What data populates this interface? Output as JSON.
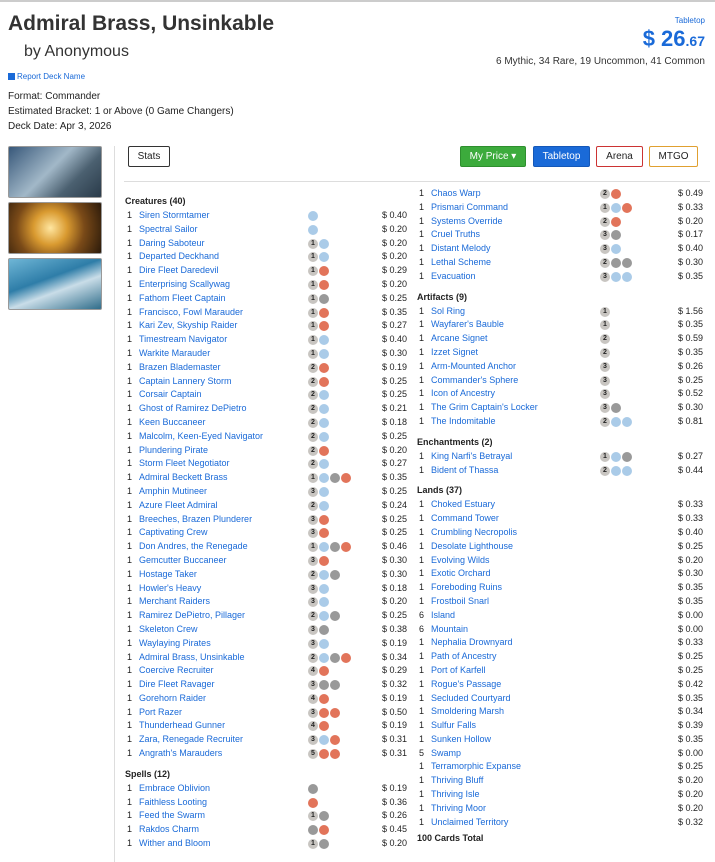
{
  "deck": {
    "title": "Admiral Brass, Unsinkable",
    "author": "by Anonymous",
    "report": "Report Deck Name",
    "format": "Format: Commander",
    "bracket": "Estimated Bracket: 1 or Above (0 Game Changers)",
    "date": "Deck Date: Apr 3, 2026"
  },
  "price": {
    "label": "Tabletop",
    "dollars": "$ 26",
    "cents": ".67"
  },
  "rarity": "6 Mythic, 34 Rare, 19 Uncommon, 41 Common",
  "buttons": {
    "stats": "Stats",
    "my_price": "My Price ▾",
    "tabletop": "Tabletop",
    "arena": "Arena",
    "mtgo": "MTGO"
  },
  "colors": {
    "link": "#1a6ad8",
    "green": "#3cab3c",
    "red": "#cc3333",
    "orange": "#e0a030",
    "blue_mana": "#aacbe8",
    "red_mana": "#e2745a",
    "black_mana": "#999999",
    "generic_mana": "#c8c5c1"
  },
  "creatures_header": "Creatures (40)",
  "creatures": [
    {
      "q": "1",
      "n": "Siren Stormtamer",
      "m": [
        "U"
      ],
      "p": "$ 0.40"
    },
    {
      "q": "1",
      "n": "Spectral Sailor",
      "m": [
        "U"
      ],
      "p": "$ 0.20"
    },
    {
      "q": "1",
      "n": "Daring Saboteur",
      "m": [
        "1",
        "U"
      ],
      "p": "$ 0.20"
    },
    {
      "q": "1",
      "n": "Departed Deckhand",
      "m": [
        "1",
        "U"
      ],
      "p": "$ 0.20"
    },
    {
      "q": "1",
      "n": "Dire Fleet Daredevil",
      "m": [
        "1",
        "R"
      ],
      "p": "$ 0.29"
    },
    {
      "q": "1",
      "n": "Enterprising Scallywag",
      "m": [
        "1",
        "R"
      ],
      "p": "$ 0.20"
    },
    {
      "q": "1",
      "n": "Fathom Fleet Captain",
      "m": [
        "1",
        "B"
      ],
      "p": "$ 0.25"
    },
    {
      "q": "1",
      "n": "Francisco, Fowl Marauder",
      "m": [
        "1",
        "R"
      ],
      "p": "$ 0.35"
    },
    {
      "q": "1",
      "n": "Kari Zev, Skyship Raider",
      "m": [
        "1",
        "R"
      ],
      "p": "$ 0.27"
    },
    {
      "q": "1",
      "n": "Timestream Navigator",
      "m": [
        "1",
        "U"
      ],
      "p": "$ 0.40"
    },
    {
      "q": "1",
      "n": "Warkite Marauder",
      "m": [
        "1",
        "U"
      ],
      "p": "$ 0.30"
    },
    {
      "q": "1",
      "n": "Brazen Blademaster",
      "m": [
        "2",
        "R"
      ],
      "p": "$ 0.19"
    },
    {
      "q": "1",
      "n": "Captain Lannery Storm",
      "m": [
        "2",
        "R"
      ],
      "p": "$ 0.25"
    },
    {
      "q": "1",
      "n": "Corsair Captain",
      "m": [
        "2",
        "U"
      ],
      "p": "$ 0.25"
    },
    {
      "q": "1",
      "n": "Ghost of Ramirez DePietro",
      "m": [
        "2",
        "U"
      ],
      "p": "$ 0.21"
    },
    {
      "q": "1",
      "n": "Keen Buccaneer",
      "m": [
        "2",
        "U"
      ],
      "p": "$ 0.18"
    },
    {
      "q": "1",
      "n": "Malcolm, Keen-Eyed Navigator",
      "m": [
        "2",
        "U"
      ],
      "p": "$ 0.25"
    },
    {
      "q": "1",
      "n": "Plundering Pirate",
      "m": [
        "2",
        "R"
      ],
      "p": "$ 0.20"
    },
    {
      "q": "1",
      "n": "Storm Fleet Negotiator",
      "m": [
        "2",
        "U"
      ],
      "p": "$ 0.27"
    },
    {
      "q": "1",
      "n": "Admiral Beckett Brass",
      "m": [
        "1",
        "U",
        "B",
        "R"
      ],
      "p": "$ 0.35"
    },
    {
      "q": "1",
      "n": "Amphin Mutineer",
      "m": [
        "3",
        "U"
      ],
      "p": "$ 0.25"
    },
    {
      "q": "1",
      "n": "Azure Fleet Admiral",
      "m": [
        "2",
        "U"
      ],
      "p": "$ 0.24"
    },
    {
      "q": "1",
      "n": "Breeches, Brazen Plunderer",
      "m": [
        "3",
        "R"
      ],
      "p": "$ 0.25"
    },
    {
      "q": "1",
      "n": "Captivating Crew",
      "m": [
        "3",
        "R"
      ],
      "p": "$ 0.25"
    },
    {
      "q": "1",
      "n": "Don Andres, the Renegade",
      "m": [
        "1",
        "U",
        "B",
        "R"
      ],
      "p": "$ 0.46"
    },
    {
      "q": "1",
      "n": "Gemcutter Buccaneer",
      "m": [
        "3",
        "R"
      ],
      "p": "$ 0.30"
    },
    {
      "q": "1",
      "n": "Hostage Taker",
      "m": [
        "2",
        "U",
        "B"
      ],
      "p": "$ 0.30"
    },
    {
      "q": "1",
      "n": "Howler's Heavy",
      "m": [
        "3",
        "U"
      ],
      "p": "$ 0.18"
    },
    {
      "q": "1",
      "n": "Merchant Raiders",
      "m": [
        "3",
        "U"
      ],
      "p": "$ 0.20"
    },
    {
      "q": "1",
      "n": "Ramirez DePietro, Pillager",
      "m": [
        "2",
        "U",
        "B"
      ],
      "p": "$ 0.25"
    },
    {
      "q": "1",
      "n": "Skeleton Crew",
      "m": [
        "3",
        "B"
      ],
      "p": "$ 0.38"
    },
    {
      "q": "1",
      "n": "Waylaying Pirates",
      "m": [
        "3",
        "U"
      ],
      "p": "$ 0.19"
    },
    {
      "q": "1",
      "n": "Admiral Brass, Unsinkable",
      "m": [
        "2",
        "U",
        "B",
        "R"
      ],
      "p": "$ 0.34"
    },
    {
      "q": "1",
      "n": "Coercive Recruiter",
      "m": [
        "4",
        "R"
      ],
      "p": "$ 0.29"
    },
    {
      "q": "1",
      "n": "Dire Fleet Ravager",
      "m": [
        "3",
        "B",
        "B"
      ],
      "p": "$ 0.32"
    },
    {
      "q": "1",
      "n": "Gorehorn Raider",
      "m": [
        "4",
        "R"
      ],
      "p": "$ 0.19"
    },
    {
      "q": "1",
      "n": "Port Razer",
      "m": [
        "3",
        "R",
        "R"
      ],
      "p": "$ 0.50"
    },
    {
      "q": "1",
      "n": "Thunderhead Gunner",
      "m": [
        "4",
        "R"
      ],
      "p": "$ 0.19"
    },
    {
      "q": "1",
      "n": "Zara, Renegade Recruiter",
      "m": [
        "3",
        "U",
        "R"
      ],
      "p": "$ 0.31"
    },
    {
      "q": "1",
      "n": "Angrath's Marauders",
      "m": [
        "5",
        "R",
        "R"
      ],
      "p": "$ 0.31"
    }
  ],
  "spells_header": "Spells (12)",
  "spells_left": [
    {
      "q": "1",
      "n": "Embrace Oblivion",
      "m": [
        "B"
      ],
      "p": "$ 0.19"
    },
    {
      "q": "1",
      "n": "Faithless Looting",
      "m": [
        "R"
      ],
      "p": "$ 0.36"
    },
    {
      "q": "1",
      "n": "Feed the Swarm",
      "m": [
        "1",
        "B"
      ],
      "p": "$ 0.26"
    },
    {
      "q": "1",
      "n": "Rakdos Charm",
      "m": [
        "B",
        "R"
      ],
      "p": "$ 0.45"
    },
    {
      "q": "1",
      "n": "Wither and Bloom",
      "m": [
        "1",
        "B"
      ],
      "p": "$ 0.20"
    }
  ],
  "spells_right": [
    {
      "q": "1",
      "n": "Chaos Warp",
      "m": [
        "2",
        "R"
      ],
      "p": "$ 0.49"
    },
    {
      "q": "1",
      "n": "Prismari Command",
      "m": [
        "1",
        "U",
        "R"
      ],
      "p": "$ 0.33"
    },
    {
      "q": "1",
      "n": "Systems Override",
      "m": [
        "2",
        "R"
      ],
      "p": "$ 0.20"
    },
    {
      "q": "1",
      "n": "Cruel Truths",
      "m": [
        "3",
        "B"
      ],
      "p": "$ 0.17"
    },
    {
      "q": "1",
      "n": "Distant Melody",
      "m": [
        "3",
        "U"
      ],
      "p": "$ 0.40"
    },
    {
      "q": "1",
      "n": "Lethal Scheme",
      "m": [
        "2",
        "B",
        "B"
      ],
      "p": "$ 0.30"
    },
    {
      "q": "1",
      "n": "Evacuation",
      "m": [
        "3",
        "U",
        "U"
      ],
      "p": "$ 0.35"
    }
  ],
  "artifacts_header": "Artifacts (9)",
  "artifacts": [
    {
      "q": "1",
      "n": "Sol Ring",
      "m": [
        "1"
      ],
      "p": "$ 1.56"
    },
    {
      "q": "1",
      "n": "Wayfarer's Bauble",
      "m": [
        "1"
      ],
      "p": "$ 0.35"
    },
    {
      "q": "1",
      "n": "Arcane Signet",
      "m": [
        "2"
      ],
      "p": "$ 0.59"
    },
    {
      "q": "1",
      "n": "Izzet Signet",
      "m": [
        "2"
      ],
      "p": "$ 0.35"
    },
    {
      "q": "1",
      "n": "Arm-Mounted Anchor",
      "m": [
        "3"
      ],
      "p": "$ 0.26"
    },
    {
      "q": "1",
      "n": "Commander's Sphere",
      "m": [
        "3"
      ],
      "p": "$ 0.25"
    },
    {
      "q": "1",
      "n": "Icon of Ancestry",
      "m": [
        "3"
      ],
      "p": "$ 0.52"
    },
    {
      "q": "1",
      "n": "The Grim Captain's Locker",
      "m": [
        "3",
        "B"
      ],
      "p": "$ 0.30"
    },
    {
      "q": "1",
      "n": "The Indomitable",
      "m": [
        "2",
        "U",
        "U"
      ],
      "p": "$ 0.81"
    }
  ],
  "enchantments_header": "Enchantments (2)",
  "enchantments": [
    {
      "q": "1",
      "n": "King Narfi's Betrayal",
      "m": [
        "1",
        "U",
        "B"
      ],
      "p": "$ 0.27"
    },
    {
      "q": "1",
      "n": "Bident of Thassa",
      "m": [
        "2",
        "U",
        "U"
      ],
      "p": "$ 0.44"
    }
  ],
  "lands_header": "Lands (37)",
  "lands": [
    {
      "q": "1",
      "n": "Choked Estuary",
      "m": [],
      "p": "$ 0.33"
    },
    {
      "q": "1",
      "n": "Command Tower",
      "m": [],
      "p": "$ 0.33"
    },
    {
      "q": "1",
      "n": "Crumbling Necropolis",
      "m": [],
      "p": "$ 0.40"
    },
    {
      "q": "1",
      "n": "Desolate Lighthouse",
      "m": [],
      "p": "$ 0.25"
    },
    {
      "q": "1",
      "n": "Evolving Wilds",
      "m": [],
      "p": "$ 0.20"
    },
    {
      "q": "1",
      "n": "Exotic Orchard",
      "m": [],
      "p": "$ 0.30"
    },
    {
      "q": "1",
      "n": "Foreboding Ruins",
      "m": [],
      "p": "$ 0.35"
    },
    {
      "q": "1",
      "n": "Frostboil Snarl",
      "m": [],
      "p": "$ 0.35"
    },
    {
      "q": "6",
      "n": "Island",
      "m": [],
      "p": "$ 0.00"
    },
    {
      "q": "6",
      "n": "Mountain",
      "m": [],
      "p": "$ 0.00"
    },
    {
      "q": "1",
      "n": "Nephalia Drownyard",
      "m": [],
      "p": "$ 0.33"
    },
    {
      "q": "1",
      "n": "Path of Ancestry",
      "m": [],
      "p": "$ 0.25"
    },
    {
      "q": "1",
      "n": "Port of Karfell",
      "m": [],
      "p": "$ 0.25"
    },
    {
      "q": "1",
      "n": "Rogue's Passage",
      "m": [],
      "p": "$ 0.42"
    },
    {
      "q": "1",
      "n": "Secluded Courtyard",
      "m": [],
      "p": "$ 0.35"
    },
    {
      "q": "1",
      "n": "Smoldering Marsh",
      "m": [],
      "p": "$ 0.34"
    },
    {
      "q": "1",
      "n": "Sulfur Falls",
      "m": [],
      "p": "$ 0.39"
    },
    {
      "q": "1",
      "n": "Sunken Hollow",
      "m": [],
      "p": "$ 0.35"
    },
    {
      "q": "5",
      "n": "Swamp",
      "m": [],
      "p": "$ 0.00"
    },
    {
      "q": "1",
      "n": "Terramorphic Expanse",
      "m": [],
      "p": "$ 0.25"
    },
    {
      "q": "1",
      "n": "Thriving Bluff",
      "m": [],
      "p": "$ 0.20"
    },
    {
      "q": "1",
      "n": "Thriving Isle",
      "m": [],
      "p": "$ 0.20"
    },
    {
      "q": "1",
      "n": "Thriving Moor",
      "m": [],
      "p": "$ 0.20"
    },
    {
      "q": "1",
      "n": "Unclaimed Territory",
      "m": [],
      "p": "$ 0.32"
    }
  ],
  "total": "100 Cards Total"
}
